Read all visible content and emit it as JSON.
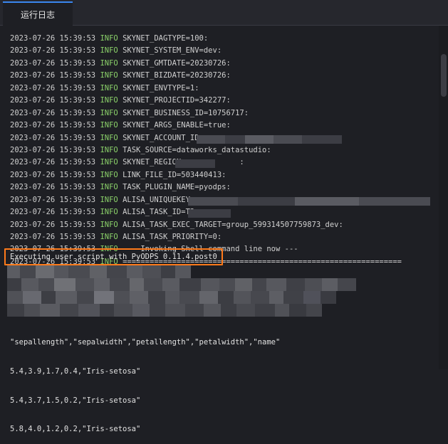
{
  "tab": {
    "label": "运行日志"
  },
  "log": {
    "level": "INFO",
    "lines": [
      {
        "ts": "2023-07-26 15:39:53",
        "msg": "SKYNET_DAGTYPE=100:"
      },
      {
        "ts": "2023-07-26 15:39:53",
        "msg": "SKYNET_SYSTEM_ENV=dev:"
      },
      {
        "ts": "2023-07-26 15:39:53",
        "msg": "SKYNET_GMTDATE=20230726:"
      },
      {
        "ts": "2023-07-26 15:39:53",
        "msg": "SKYNET_BIZDATE=20230726:"
      },
      {
        "ts": "2023-07-26 15:39:53",
        "msg": "SKYNET_ENVTYPE=1:"
      },
      {
        "ts": "2023-07-26 15:39:53",
        "msg": "SKYNET_PROJECTID=342277:"
      },
      {
        "ts": "2023-07-26 15:39:53",
        "msg": "SKYNET_BUSINESS_ID=10756717:"
      },
      {
        "ts": "2023-07-26 15:39:53",
        "msg": "SKYNET_ARGS_ENABLE=true:"
      },
      {
        "ts": "2023-07-26 15:39:53",
        "msg": "SKYNET_ACCOUNT_ID="
      },
      {
        "ts": "2023-07-26 15:39:53",
        "msg": "TASK_SOURCE=dataworks_datastudio:"
      },
      {
        "ts": "2023-07-26 15:39:53",
        "msg": "SKYNET_REGION=            :"
      },
      {
        "ts": "2023-07-26 15:39:53",
        "msg": "LINK_FILE_ID=503440413:"
      },
      {
        "ts": "2023-07-26 15:39:53",
        "msg": "TASK_PLUGIN_NAME=pyodps:"
      },
      {
        "ts": "2023-07-26 15:39:53",
        "msg": "ALISA_UNIQUEKEY="
      },
      {
        "ts": "2023-07-26 15:39:53",
        "msg": "ALISA_TASK_ID=T3"
      },
      {
        "ts": "2023-07-26 15:39:53",
        "msg": "ALISA_TASK_EXEC_TARGET=group_599314507759873_dev:"
      },
      {
        "ts": "2023-07-26 15:39:53",
        "msg": "ALISA_TASK_PRIORITY=0:"
      },
      {
        "ts": "2023-07-26 15:39:53",
        "msg": "--- Invoking Shell command line now ---"
      },
      {
        "ts": "2023-07-26 15:39:53",
        "msg": "=============================================================="
      }
    ]
  },
  "exec_line": "Executing user script with PyODPS 0.11.4.post0",
  "csv_output": [
    "\"sepallength\",\"sepalwidth\",\"petallength\",\"petalwidth\",\"name\"",
    "5.4,3.9,1.7,0.4,\"Iris-setosa\"",
    "5.4,3.7,1.5,0.2,\"Iris-setosa\"",
    "5.8,4.0,1.2,0.2,\"Iris-setosa\""
  ],
  "colors": {
    "background": "#1e1f24",
    "info_level": "#8bd26a",
    "tab_accent": "#3a87f0",
    "highlight_border": "#ff7a1a"
  }
}
